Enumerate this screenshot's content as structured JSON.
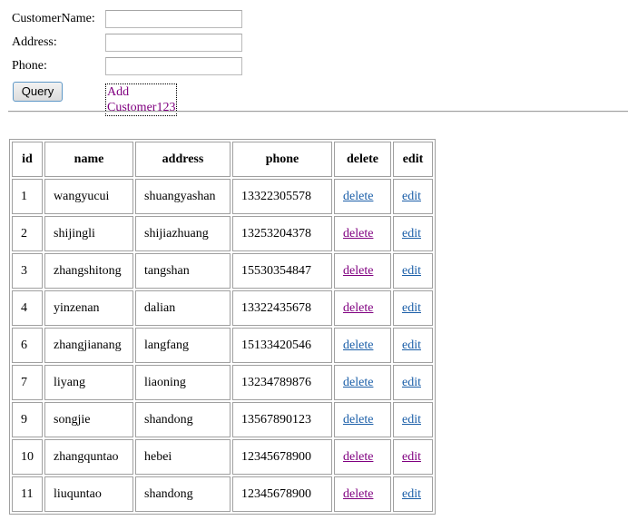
{
  "form": {
    "customer_name_label": "CustomerName:",
    "address_label": "Address:",
    "phone_label": "Phone:",
    "customer_name_value": "",
    "address_value": "",
    "phone_value": "",
    "query_button": "Query",
    "add_link": "Add Customer123"
  },
  "table": {
    "headers": [
      "id",
      "name",
      "address",
      "phone",
      "delete",
      "edit"
    ],
    "rows": [
      {
        "id": "1",
        "name": "wangyucui",
        "address": "shuangyashan",
        "phone": "13322305578",
        "delete": "delete",
        "edit": "edit",
        "delete_visited": false,
        "edit_visited": false
      },
      {
        "id": "2",
        "name": "shijingli",
        "address": "shijiazhuang",
        "phone": "13253204378",
        "delete": "delete",
        "edit": "edit",
        "delete_visited": true,
        "edit_visited": false
      },
      {
        "id": "3",
        "name": "zhangshitong",
        "address": "tangshan",
        "phone": "15530354847",
        "delete": "delete",
        "edit": "edit",
        "delete_visited": true,
        "edit_visited": false
      },
      {
        "id": "4",
        "name": "yinzenan",
        "address": "dalian",
        "phone": "13322435678",
        "delete": "delete",
        "edit": "edit",
        "delete_visited": true,
        "edit_visited": false
      },
      {
        "id": "6",
        "name": "zhangjianang",
        "address": "langfang",
        "phone": "15133420546",
        "delete": "delete",
        "edit": "edit",
        "delete_visited": false,
        "edit_visited": false
      },
      {
        "id": "7",
        "name": "liyang",
        "address": "liaoning",
        "phone": "13234789876",
        "delete": "delete",
        "edit": "edit",
        "delete_visited": false,
        "edit_visited": false
      },
      {
        "id": "9",
        "name": "songjie",
        "address": "shandong",
        "phone": "13567890123",
        "delete": "delete",
        "edit": "edit",
        "delete_visited": false,
        "edit_visited": false
      },
      {
        "id": "10",
        "name": "zhangquntao",
        "address": "hebei",
        "phone": "12345678900",
        "delete": "delete",
        "edit": "edit",
        "delete_visited": true,
        "edit_visited": true
      },
      {
        "id": "11",
        "name": "liuquntao",
        "address": "shandong",
        "phone": "12345678900",
        "delete": "delete",
        "edit": "edit",
        "delete_visited": true,
        "edit_visited": false
      }
    ]
  },
  "colors": {
    "link": "#1a5ea8",
    "visited_link": "#800080",
    "border": "#a0a0a0"
  }
}
